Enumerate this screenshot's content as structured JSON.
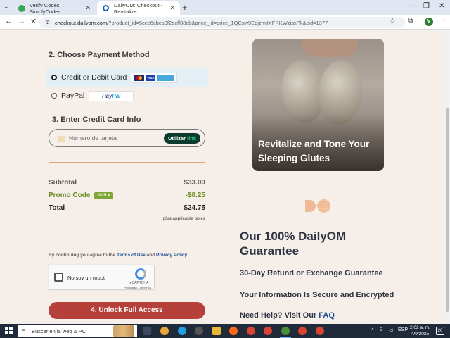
{
  "browser": {
    "tabs": [
      {
        "title": "Verify Codes — SimplyCodes"
      },
      {
        "title": "DailyOM: Checkout - Revitalize"
      }
    ],
    "url_host": "checkout.dailyom.com",
    "url_rest": "/?product_id=5cce6cbcb0f2acff88cb&price_id=price_1QCsw9EdjzmjtXFRKWzjsxPk&cid=1377",
    "profile_initial": "V"
  },
  "payment": {
    "heading": "2. Choose Payment Method",
    "option_card": "Credit or Debit Card",
    "option_paypal": "PayPal",
    "paypal_logo_1": "Pay",
    "paypal_logo_2": "Pal",
    "visa_label": "VISA",
    "card_heading": "3. Enter Credit Card Info",
    "card_placeholder": "Número de tarjeta",
    "link_btn_1": "Utilizar ",
    "link_btn_2": "link"
  },
  "summary": {
    "subtotal_label": "Subtotal",
    "subtotal_value": "$33.00",
    "promo_label": "Promo Code",
    "promo_badge": "2025 ×",
    "promo_value": "-$8.25",
    "total_label": "Total",
    "total_value": "$24.75",
    "tax_note": "plus applicable taxes"
  },
  "terms": {
    "prefix": "By continuing you agree to the ",
    "terms_link": "Terms of Use",
    "and": " and ",
    "privacy_link": "Privacy Policy",
    "suffix": "."
  },
  "captcha": {
    "label": "No soy un robot",
    "brand": "reCAPTCHA",
    "links": "Privacidad - Términos"
  },
  "cta": {
    "label": "4. Unlock Full Access"
  },
  "hero": {
    "text": "Revitalize and Tone Your Sleeping Glutes"
  },
  "guarantee": {
    "title": "Our 100% DailyOM Guarantee",
    "line1": "30-Day Refund or Exchange Guarantee",
    "line2": "Your Information Is Secure and Encrypted",
    "line3_prefix": "Need Help? Visit Our ",
    "line3_link": "FAQ"
  },
  "taskbar": {
    "search_placeholder": "Buscar en la web & PC",
    "lang": "ESP",
    "time": "2:02 a. m.",
    "date": "4/9/2025",
    "notif_count": "20"
  },
  "colors": {
    "page_bg": "#f6efe9",
    "cta": "#b6403a",
    "promo": "#6a8b1f",
    "link": "#1d4f91",
    "accent_rule": "#e2a47a"
  }
}
